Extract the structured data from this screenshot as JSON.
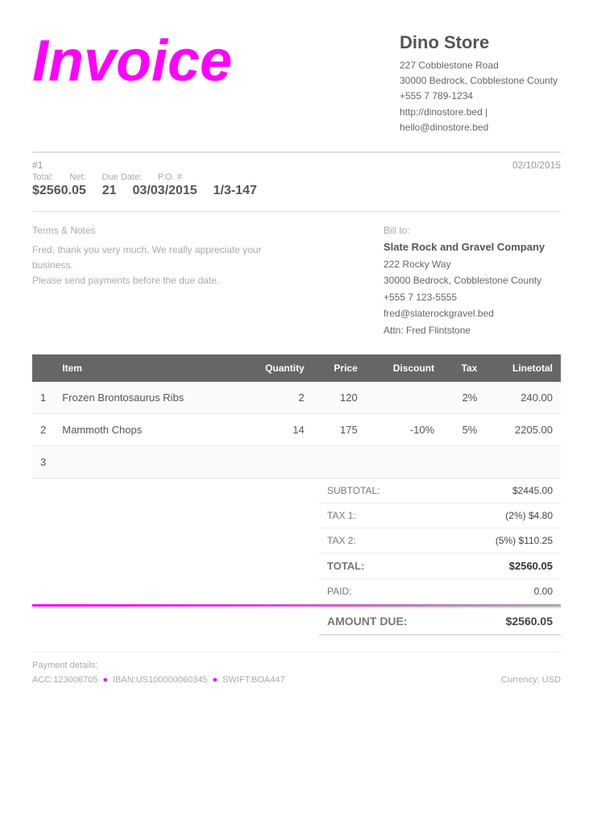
{
  "invoice": {
    "title": "Invoice",
    "number": "#1",
    "date": "02/10/2015",
    "total_label": "Total:",
    "net_label": "Net:",
    "due_date_label": "Due Date:",
    "po_label": "P.O. #",
    "total_value": "$2560.05",
    "net_value": "21",
    "due_date_value": "03/03/2015",
    "po_value": "1/3-147"
  },
  "company": {
    "name": "Dino Store",
    "address1": "227 Cobblestone Road",
    "address2": "30000 Bedrock, Cobblestone County",
    "phone": "+555 7 789-1234",
    "website": "http://dinostore.bed |",
    "email": "hello@dinostore.bed"
  },
  "terms": {
    "title": "Terms & Notes",
    "text": "Fred, thank you very much. We really appreciate your business.\nPlease send payments before the due date."
  },
  "bill_to": {
    "label": "Bill to:",
    "company": "Slate Rock and Gravel Company",
    "address1": "222 Rocky Way",
    "address2": "30000 Bedrock, Cobblestone County",
    "phone": "+555 7 123-5555",
    "email": "fred@slaterockgravel.bed",
    "attn": "Attn: Fred Flintstone"
  },
  "table": {
    "headers": [
      "Item",
      "Quantity",
      "Price",
      "Discount",
      "Tax",
      "Linetotal"
    ],
    "rows": [
      {
        "num": "1",
        "item": "Frozen Brontosaurus Ribs",
        "quantity": "2",
        "price": "120",
        "discount": "",
        "tax": "2%",
        "linetotal": "240.00"
      },
      {
        "num": "2",
        "item": "Mammoth Chops",
        "quantity": "14",
        "price": "175",
        "discount": "-10%",
        "tax": "5%",
        "linetotal": "2205.00"
      },
      {
        "num": "3",
        "item": "",
        "quantity": "",
        "price": "",
        "discount": "",
        "tax": "",
        "linetotal": ""
      }
    ]
  },
  "totals": {
    "subtotal_label": "SUBTOTAL:",
    "subtotal_value": "$2445.00",
    "tax1_label": "TAX 1:",
    "tax1_value": "(2%) $4.80",
    "tax2_label": "TAX 2:",
    "tax2_value": "(5%) $110.25",
    "total_label": "TOTAL:",
    "total_value": "$2560.05",
    "paid_label": "PAID:",
    "paid_value": "0.00",
    "amount_due_label": "AMOUNT DUE:",
    "amount_due_value": "$2560.05"
  },
  "footer": {
    "payment_label": "Payment details:",
    "acc": "ACC:123006705",
    "iban": "IBAN:US100000060345",
    "swift": "SWIFT:BOA447",
    "currency": "Currency: USD"
  },
  "colors": {
    "accent": "#ff00ff",
    "header_bg": "#666666"
  }
}
